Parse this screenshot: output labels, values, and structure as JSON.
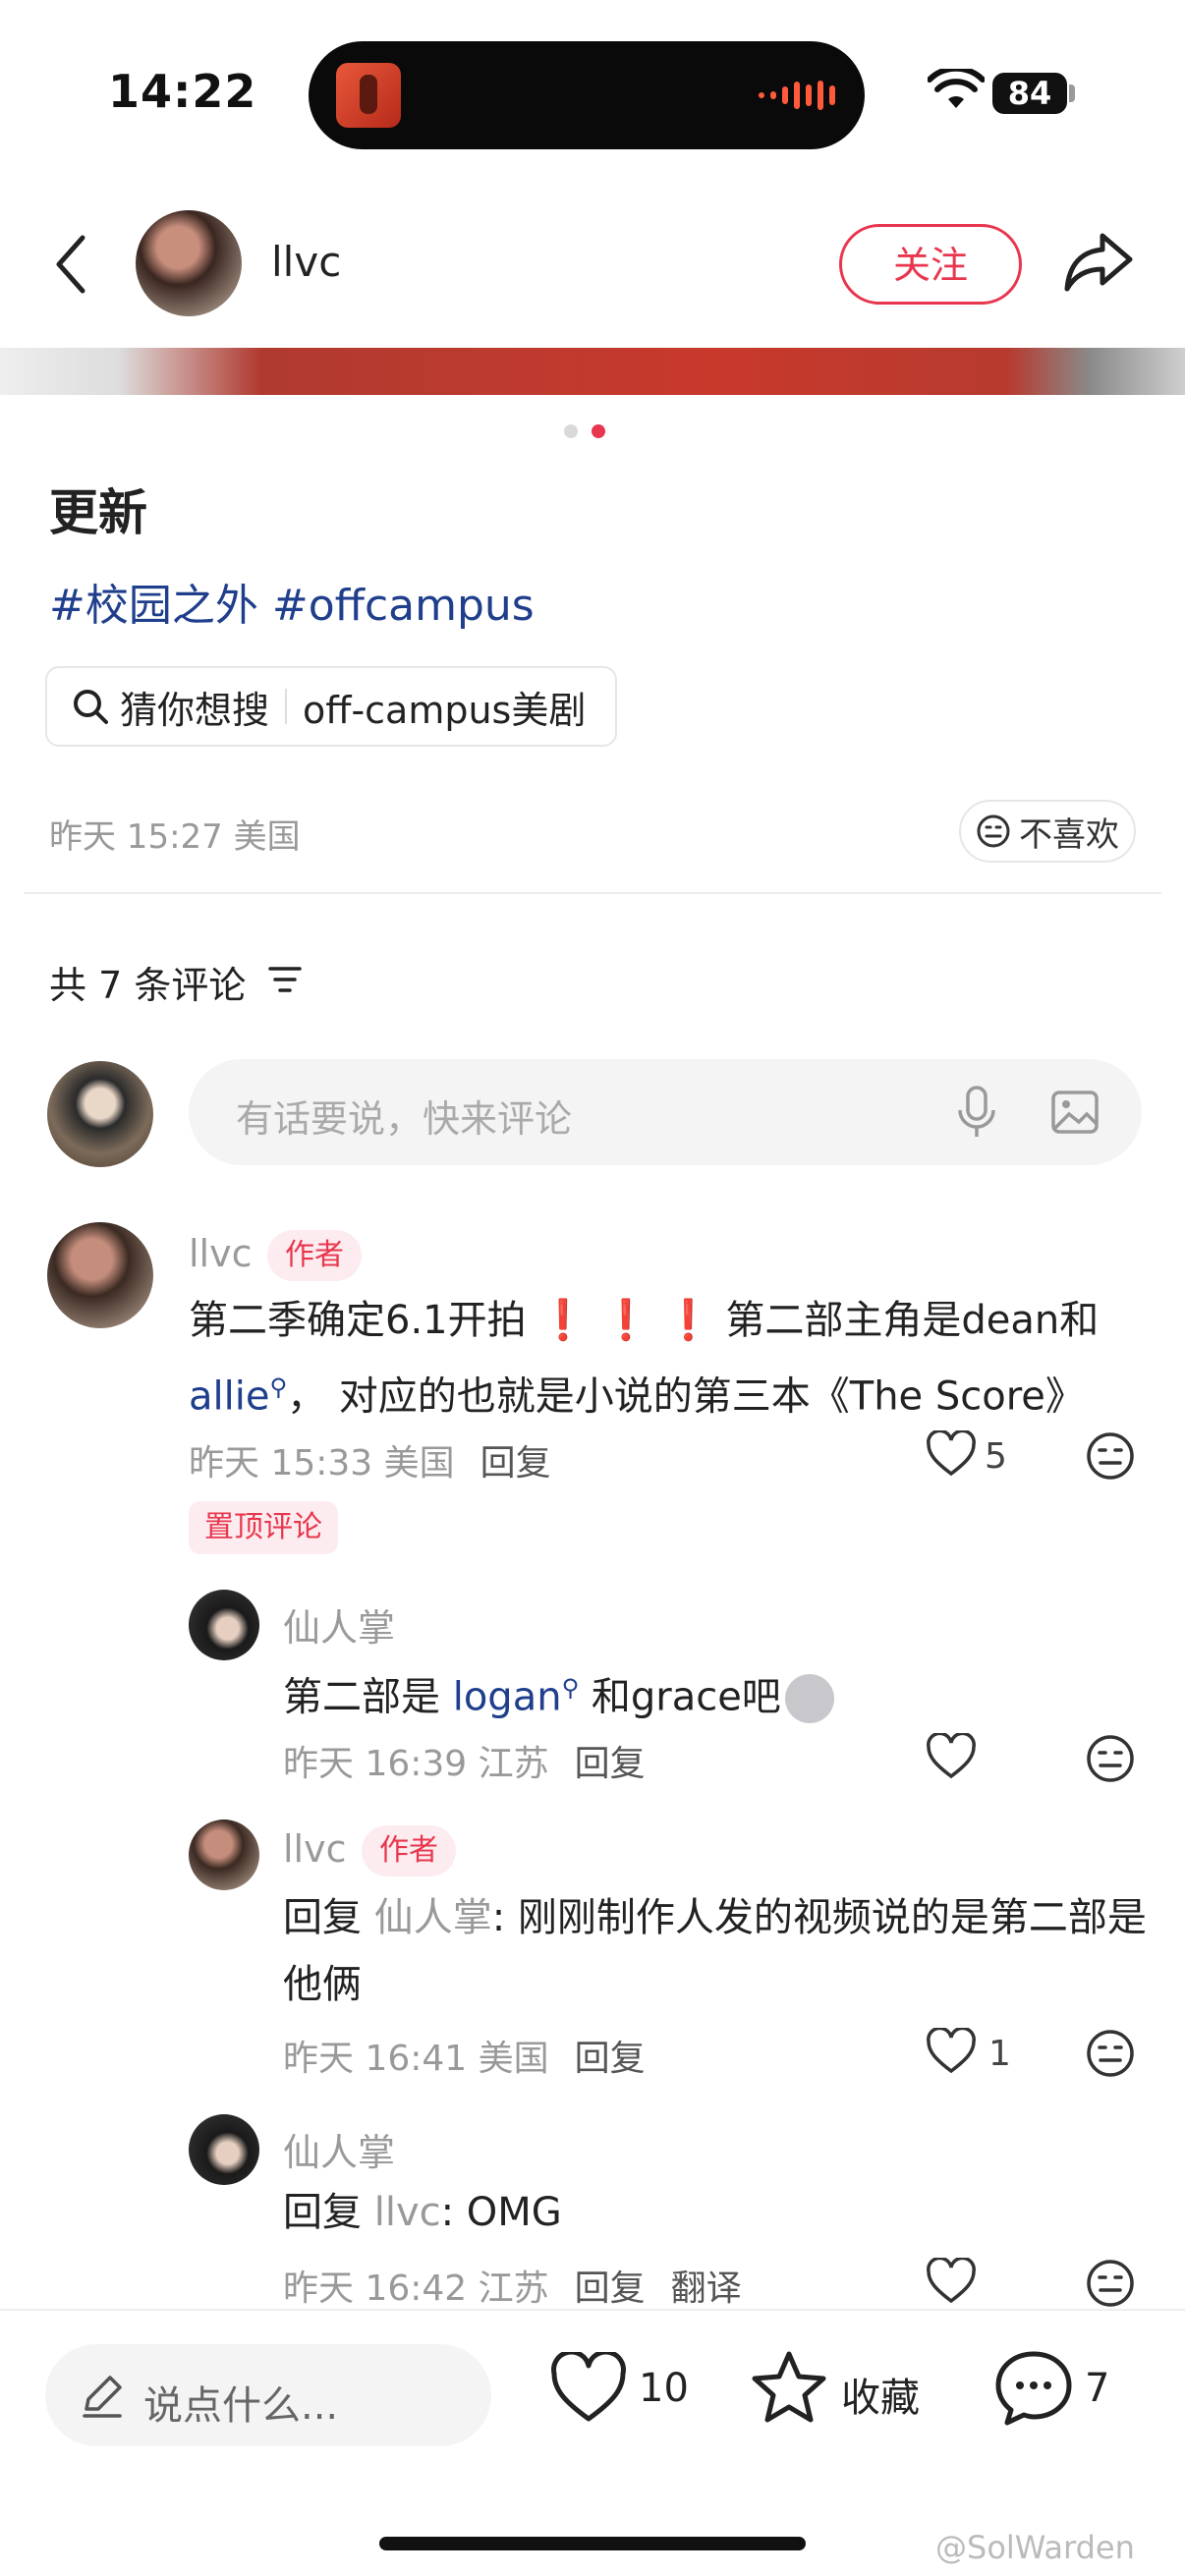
{
  "status": {
    "time": "14:22",
    "battery": "84"
  },
  "header": {
    "author_name": "llvc",
    "follow_label": "关注"
  },
  "post": {
    "title": "更新",
    "hashtags": "#校园之外 #offcampus",
    "search_label": "猜你想搜",
    "search_query": "off-campus美剧",
    "date": "昨天 15:27 美国",
    "dislike_label": "不喜欢"
  },
  "comments_section": {
    "count_label": "共 7 条评论",
    "input_placeholder": "有话要说，快来评论"
  },
  "comments": {
    "c1": {
      "name": "llvc",
      "badge": "作者",
      "text_a": "第二季确定6.1开拍",
      "text_b": "第二部主角是dean和",
      "link": "allie",
      "text_c": "， 对应的也就是小说的第三本《The Score》",
      "meta": "昨天 15:33 美国",
      "reply": "回复",
      "likes": "5",
      "pinned": "置顶评论"
    },
    "r1": {
      "name": "仙人掌",
      "text_a": "第二部是",
      "link": "logan",
      "text_b": "和grace吧",
      "meta": "昨天 16:39 江苏",
      "reply": "回复"
    },
    "r2": {
      "name": "llvc",
      "badge": "作者",
      "reply_prefix": "回复",
      "reply_to": "仙人掌",
      "text": ": 刚刚制作人发的视频说的是第二部是他俩",
      "meta": "昨天 16:41 美国",
      "reply": "回复",
      "likes": "1"
    },
    "r3": {
      "name": "仙人掌",
      "reply_prefix": "回复",
      "reply_to": "llvc",
      "text": ": OMG",
      "meta": "昨天 16:42 江苏",
      "reply": "回复",
      "translate": "翻译"
    }
  },
  "bottom_bar": {
    "say_placeholder": "说点什么...",
    "like_count": "10",
    "favorite_label": "收藏",
    "comment_count": "7"
  },
  "watermark": "@SolWarden"
}
